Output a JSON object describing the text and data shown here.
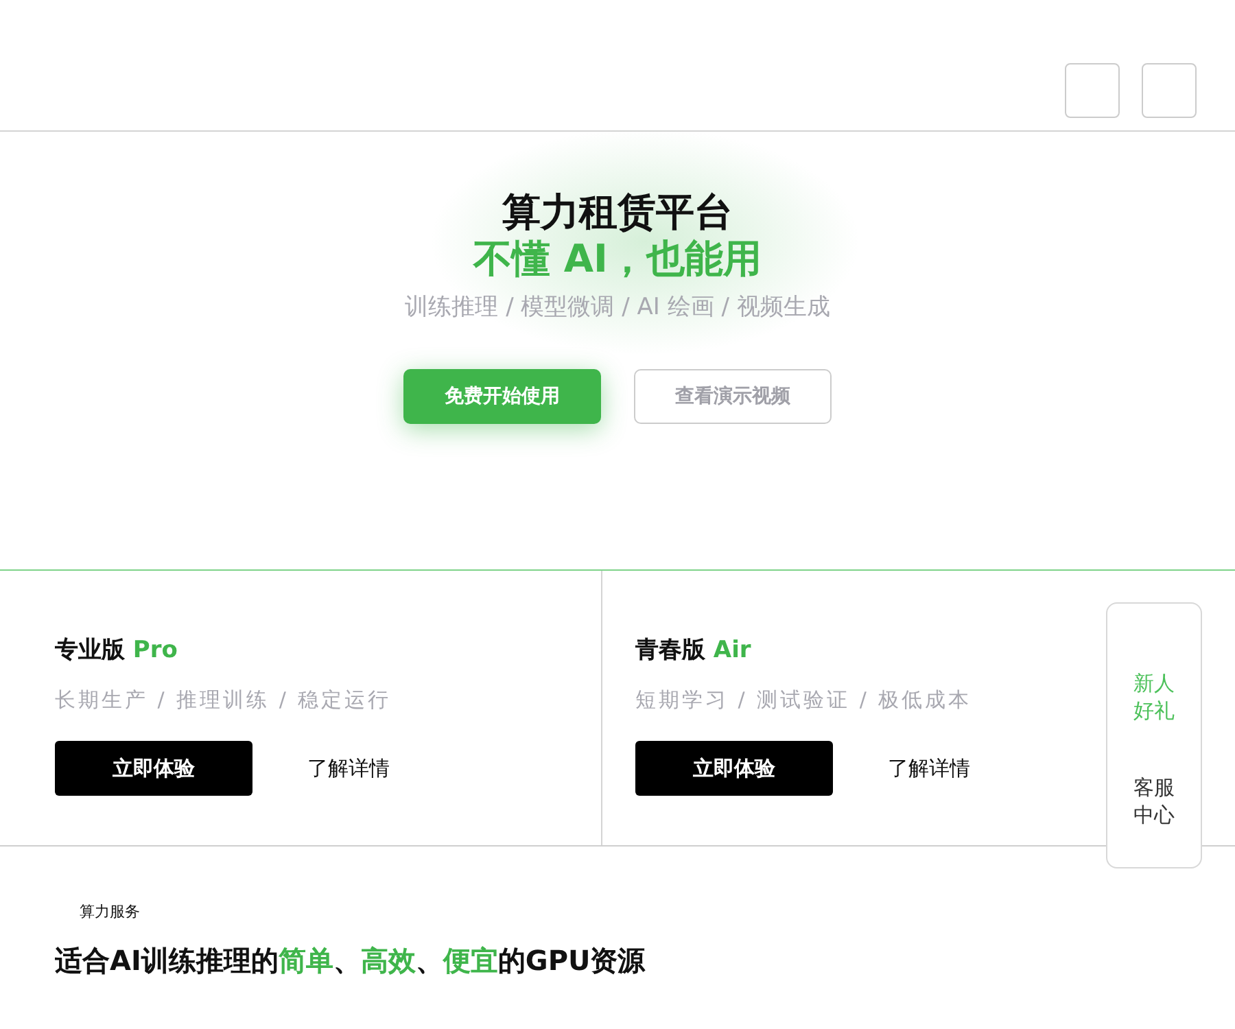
{
  "header": {
    "buttons": [
      {
        "kind": "blank"
      },
      {
        "kind": "blank"
      }
    ]
  },
  "hero": {
    "title": "算力租赁平台",
    "slogan": "不懂 AI，也能用",
    "tagline": "训练推理 / 模型微调 / AI 绘画 / 视频生成",
    "buttons": [
      {
        "label": "免费开始使用",
        "kind": "primary"
      },
      {
        "label": "查看演示视频",
        "kind": "outline"
      }
    ]
  },
  "plans": [
    {
      "name": "专业版",
      "tag": "Pro",
      "features": "长期生产 / 推理训练 / 稳定运行",
      "cta": "立即体验",
      "link": "了解详情"
    },
    {
      "name": "青春版",
      "tag": "Air",
      "features": "短期学习 / 测试验证 / 极低成本",
      "cta": "立即体验",
      "link": "了解详情"
    }
  ],
  "side_panel": {
    "items": [
      {
        "label": "新人好礼",
        "highlight": true
      },
      {
        "label": "客服中心",
        "highlight": false
      }
    ]
  },
  "services": {
    "eyebrow": "算力服务",
    "heading": [
      {
        "text": "适合AI训练推理的",
        "highlight": false
      },
      {
        "text": "简单",
        "highlight": true
      },
      {
        "text": "、",
        "highlight": false
      },
      {
        "text": "高效",
        "highlight": true
      },
      {
        "text": "、",
        "highlight": false
      },
      {
        "text": "便宜",
        "highlight": true
      },
      {
        "text": "的GPU资源",
        "highlight": false
      }
    ]
  }
}
